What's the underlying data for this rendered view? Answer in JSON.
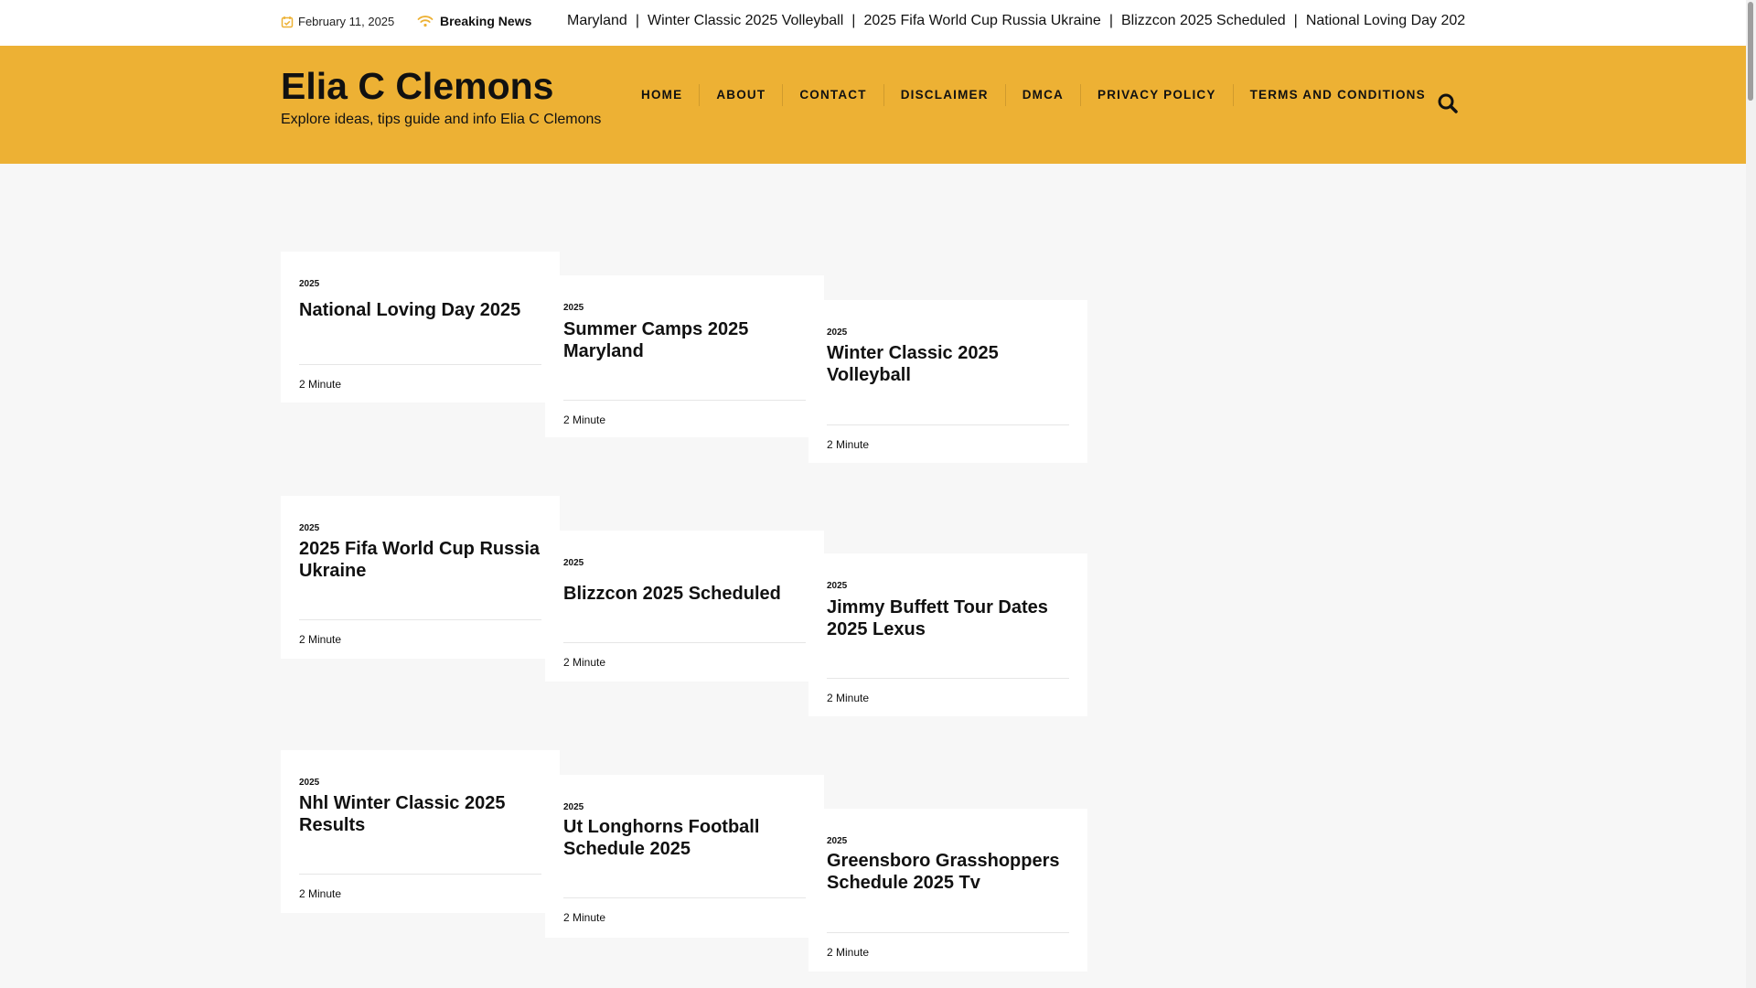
{
  "topbar": {
    "date": "February 11, 2025",
    "breaking_label": "Breaking News",
    "ticker": [
      "Maryland",
      "Winter Classic 2025 Volleyball",
      "2025 Fifa World Cup Russia Ukraine",
      "Blizzcon 2025 Scheduled",
      "National Loving Day 202"
    ],
    "ticker_separator": "|"
  },
  "header": {
    "site_title": "Elia C Clemons",
    "tagline": "Explore ideas, tips guide and info Elia C Clemons"
  },
  "nav": {
    "items": [
      "HOME",
      "ABOUT",
      "CONTACT",
      "DISCLAIMER",
      "DMCA",
      "PRIVACY POLICY",
      "TERMS AND CONDITIONS"
    ]
  },
  "posts": [
    {
      "category": "2025",
      "title": "National Loving Day 2025",
      "read_time": "2 Minute"
    },
    {
      "category": "2025",
      "title": "Summer Camps 2025 Maryland",
      "read_time": "2 Minute"
    },
    {
      "category": "2025",
      "title": "Winter Classic 2025 Volleyball",
      "read_time": "2 Minute"
    },
    {
      "category": "2025",
      "title": "2025 Fifa World Cup Russia Ukraine",
      "read_time": "2 Minute"
    },
    {
      "category": "2025",
      "title": "Blizzcon 2025 Scheduled",
      "read_time": "2 Minute"
    },
    {
      "category": "2025",
      "title": "Jimmy Buffett Tour Dates 2025 Lexus",
      "read_time": "2 Minute"
    },
    {
      "category": "2025",
      "title": "Nhl Winter Classic 2025 Results",
      "read_time": "2 Minute"
    },
    {
      "category": "2025",
      "title": "Ut Longhorns Football Schedule 2025",
      "read_time": "2 Minute"
    },
    {
      "category": "2025",
      "title": "Greensboro Grasshoppers Schedule 2025 Tv",
      "read_time": "2 Minute"
    }
  ],
  "colors": {
    "header_bg": "#edb134",
    "accent_icon": "#edb134",
    "page_bg": "#f7f7f7",
    "card_bg": "#ffffff"
  },
  "icons": {
    "date": "calendar-check-icon",
    "breaking": "wifi-signal-icon",
    "search": "magnifier-icon"
  }
}
